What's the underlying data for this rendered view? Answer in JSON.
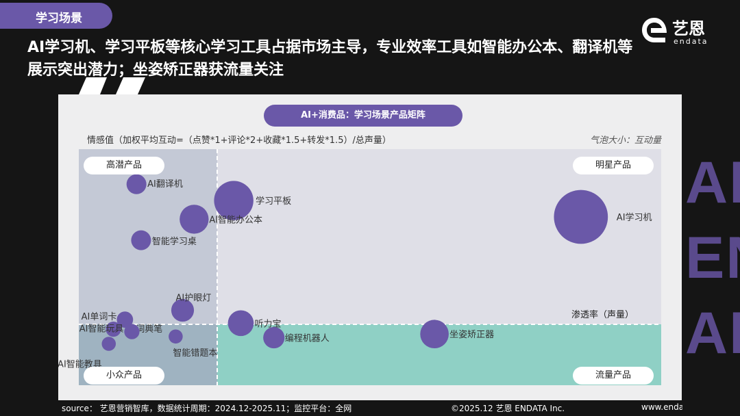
{
  "section_tag": "学习场景",
  "headline": "AI学习机、学习平板等核心学习工具占据市场主导，专业效率工具如智能办公本、翻译机等展示突出潜力；坐姿矫正器获流量关注",
  "logo": {
    "name": "艺恩",
    "sub": "endata"
  },
  "decor_letters": "AL\nEN\nAI",
  "chart_data": {
    "type": "scatter",
    "title": "AI+消费品：学习场景产品矩阵",
    "ylabel": "情感值（加权平均互动=（点赞*1+评论*2+收藏*1.5+转发*1.5）/总声量）",
    "xlabel": "渗透率（声量）",
    "bubble_note": "气泡大小：互动量",
    "quadrants": {
      "top_left": "高潜产品",
      "top_right": "明星产品",
      "bottom_left": "小众产品",
      "bottom_right": "流量产品"
    },
    "xlim": [
      0,
      100
    ],
    "ylim": [
      0,
      100
    ],
    "divider": {
      "x": 6,
      "y": 25
    },
    "points": [
      {
        "label": "AI翻译机",
        "x": 2.5,
        "y": 85,
        "size": 1
      },
      {
        "label": "学习平板",
        "x": 9.5,
        "y": 78,
        "size": 5
      },
      {
        "label": "AI智能办公本",
        "x": 5,
        "y": 70,
        "size": 2.5
      },
      {
        "label": "智能学习桌",
        "x": 2.7,
        "y": 61,
        "size": 1
      },
      {
        "label": "AI学习机",
        "x": 83,
        "y": 71,
        "size": 10
      },
      {
        "label": "AI护眼灯",
        "x": 4.5,
        "y": 31,
        "size": 1.4
      },
      {
        "label": "AI单词卡",
        "x": 2,
        "y": 27,
        "size": 0.6
      },
      {
        "label": "AI词典笔",
        "x": 1.5,
        "y": 23,
        "size": 0.5
      },
      {
        "label": "听力宝",
        "x": 11,
        "y": 25.5,
        "size": 1.9
      },
      {
        "label": "AI智能玩具",
        "x": 2.3,
        "y": 22,
        "size": 0.5
      },
      {
        "label": "智能错题本",
        "x": 4.2,
        "y": 20,
        "size": 0.4
      },
      {
        "label": "AI智能教具",
        "x": 1.3,
        "y": 17,
        "size": 0.4
      },
      {
        "label": "编程机器人",
        "x": 18,
        "y": 19.5,
        "size": 1.2
      },
      {
        "label": "坐姿矫正器",
        "x": 52,
        "y": 21,
        "size": 2.4
      }
    ],
    "colors": {
      "point": "#6a58a8",
      "quad_top_left": "#c4c9d6",
      "quad_top_right": "#dfdfe7",
      "quad_bottom_left": "#9fb3c1",
      "quad_bottom_right": "#8fd0c5"
    }
  },
  "footer": {
    "source": "source： 艺恩营销智库，数据统计周期：2024.12-2025.11；监控平台：全网",
    "copyright": "©2025.12 艺恩 ENDATA Inc.",
    "url": "www.endata.com.cn"
  }
}
